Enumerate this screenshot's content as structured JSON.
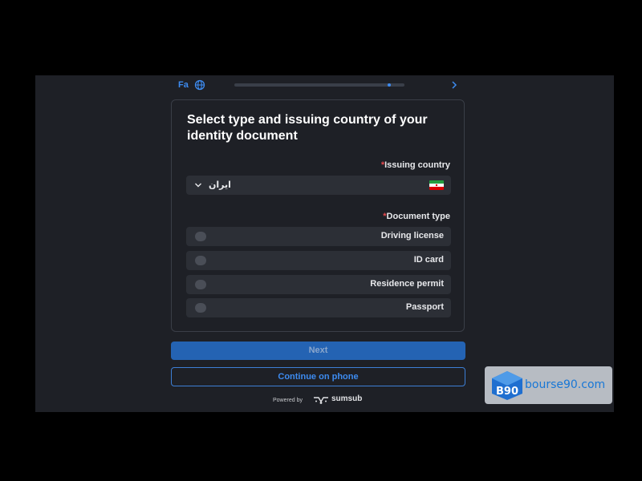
{
  "header": {
    "language_label": "Fa",
    "language_icon": "globe-icon",
    "progress": 0.92,
    "progress_segment_start": 0.9,
    "next_icon": "chevron-right-icon"
  },
  "card": {
    "title": "Select type and issuing country of your identity document",
    "issuing_country": {
      "required_mark": "*",
      "label": "Issuing country",
      "value": "ایران",
      "flag_icon": "iran-flag-icon"
    },
    "document_type": {
      "required_mark": "*",
      "label": "Document type",
      "options": [
        {
          "label": "Driving license",
          "selected": false
        },
        {
          "label": "ID card",
          "selected": false
        },
        {
          "label": "Residence permit",
          "selected": false
        },
        {
          "label": "Passport",
          "selected": false
        }
      ]
    }
  },
  "actions": {
    "next_label": "Next",
    "phone_label": "Continue on phone"
  },
  "footer": {
    "powered_by": "Powered by",
    "brand": "sumsub"
  },
  "watermark": {
    "text": "bourse90.com",
    "logo_text": "B90"
  },
  "colors": {
    "accent": "#3d8bf0",
    "button": "#2463b3",
    "background": "#1e2026",
    "field": "#2c2f36",
    "required": "#e5484d"
  }
}
